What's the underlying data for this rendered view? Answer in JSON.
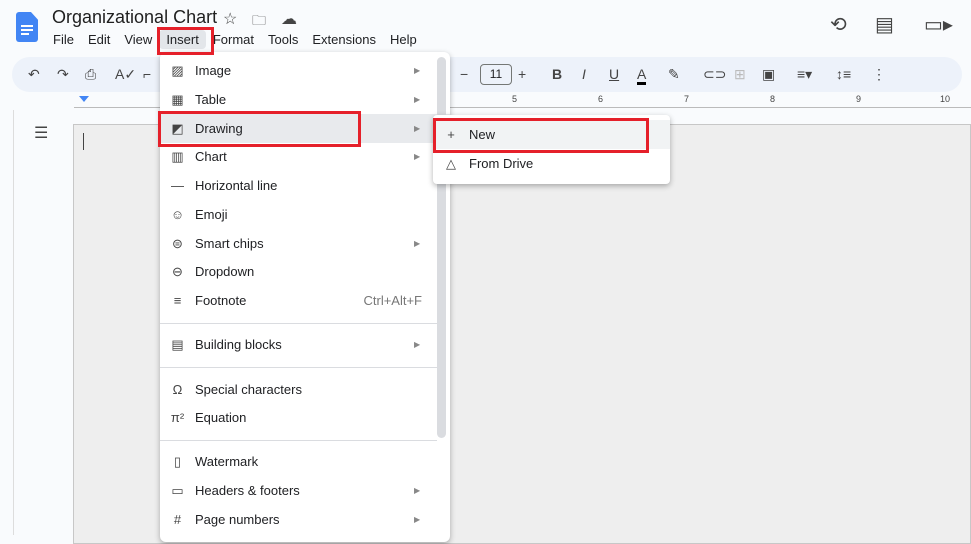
{
  "app": {
    "title": "Organizational Chart",
    "icons": [
      "star-icon",
      "move-to-folder-icon",
      "cloud-saved-icon"
    ]
  },
  "menubar": [
    "File",
    "Edit",
    "View",
    "Insert",
    "Format",
    "Tools",
    "Extensions",
    "Help"
  ],
  "right_icons": [
    "history-icon",
    "comment-icon",
    "video-call-icon"
  ],
  "toolbar": {
    "font_size": "11"
  },
  "ruler": [
    "5",
    "6",
    "7",
    "8",
    "9",
    "10"
  ],
  "insert_menu": [
    {
      "label": "Image",
      "icon": "image-icon",
      "submenu": true
    },
    {
      "label": "Table",
      "icon": "table-icon",
      "submenu": true
    },
    {
      "label": "Drawing",
      "icon": "drawing-icon",
      "submenu": true,
      "highlighted": true
    },
    {
      "label": "Chart",
      "icon": "chart-icon",
      "submenu": true
    },
    {
      "label": "Horizontal line",
      "icon": "horizontal-line-icon"
    },
    {
      "label": "Emoji",
      "icon": "emoji-icon"
    },
    {
      "label": "Smart chips",
      "icon": "smart-chips-icon",
      "submenu": true
    },
    {
      "label": "Dropdown",
      "icon": "dropdown-icon"
    },
    {
      "label": "Footnote",
      "icon": "footnote-icon",
      "shortcut": "Ctrl+Alt+F"
    },
    {
      "label": "Building blocks",
      "icon": "building-blocks-icon",
      "submenu": true
    },
    {
      "label": "Special characters",
      "icon": "omega-icon"
    },
    {
      "label": "Equation",
      "icon": "pi-icon"
    },
    {
      "label": "Watermark",
      "icon": "watermark-icon"
    },
    {
      "label": "Headers & footers",
      "icon": "headers-footers-icon",
      "submenu": true
    },
    {
      "label": "Page numbers",
      "icon": "hash-icon",
      "submenu": true
    }
  ],
  "drawing_submenu": [
    {
      "label": "New",
      "icon": "plus-icon"
    },
    {
      "label": "From Drive",
      "icon": "drive-icon"
    }
  ],
  "colors": {
    "highlight_box": "#e5202a",
    "accent": "#4285f4"
  }
}
